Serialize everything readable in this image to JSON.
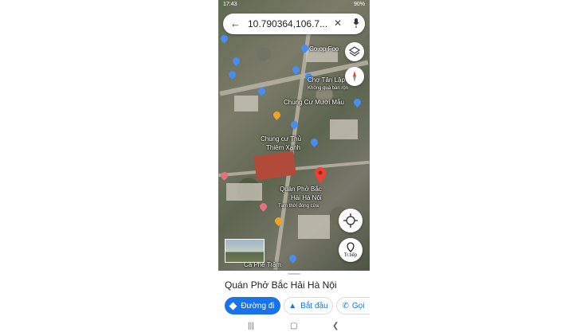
{
  "status": {
    "time": "17:43",
    "battery": "90%"
  },
  "search": {
    "query": "10.790364,106.7..."
  },
  "map": {
    "labels": {
      "coop": "Co.op Foo",
      "cho_tan_lap": "Chợ Tân Lập",
      "cho_sub": "Không quá bán rộn",
      "chung_cu_muoi_mau": "Chung Cư Mười Mẫu",
      "chung_cu_thu_thiem_1": "Chung cư Thủ",
      "chung_cu_thu_thiem_2": "Thiêm Xanh",
      "place_1": "Quán Phở Bắc",
      "place_2": "Hải Hà Nội",
      "place_status": "Tạm thời đóng cửa",
      "ca_phe": "Cà Phê Trầm"
    },
    "next_label": "Tr.tiếp"
  },
  "place": {
    "name": "Quán Phở Bắc Hải Hà Nội"
  },
  "actions": {
    "directions": "Đường đi",
    "start": "Bắt đầu",
    "call": "Gọi"
  },
  "colors": {
    "accent": "#1a73e8",
    "pin_red": "#ea4335",
    "pin_orange": "#f4a223",
    "pin_blue": "#4a8df0",
    "pin_pink": "#e8707f"
  }
}
